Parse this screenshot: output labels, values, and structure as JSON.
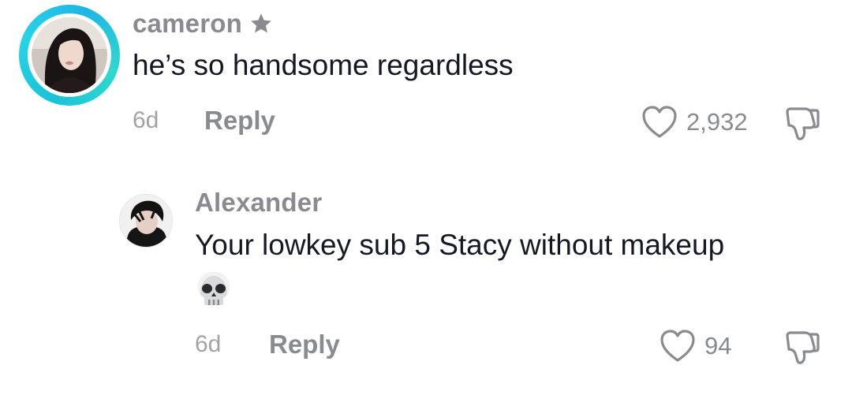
{
  "comments": [
    {
      "username": "cameron",
      "badge_icon": "star-icon",
      "text": "he’s so handsome regardless",
      "time": "6d",
      "reply_label": "Reply",
      "likes": "2,932",
      "avatar_ring_color": "#1ec4da"
    },
    {
      "username": "Alexander",
      "text": "Your lowkey sub 5 Stacy without makeup",
      "emoji": "💀",
      "time": "6d",
      "reply_label": "Reply",
      "likes": "94"
    }
  ],
  "colors": {
    "text_primary": "#161823",
    "text_secondary": "#8a8b91",
    "icon_gray": "#8a8b91"
  }
}
